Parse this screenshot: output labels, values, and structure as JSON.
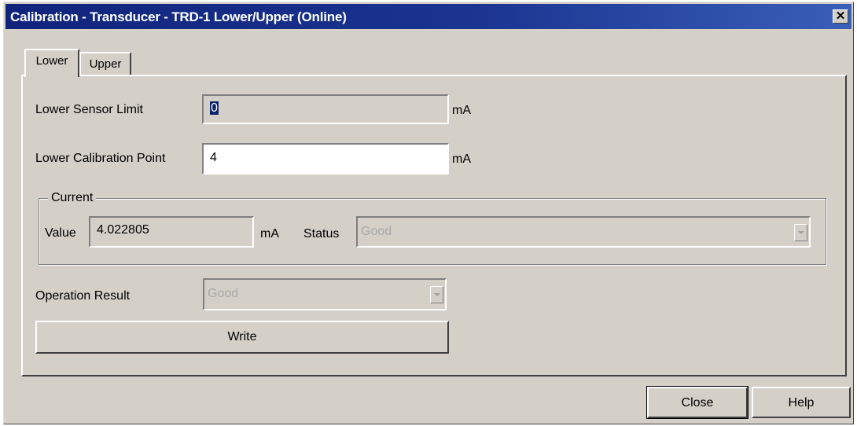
{
  "window": {
    "title": "Calibration - Transducer - TRD-1 Lower/Upper  (Online)",
    "close_glyph": "✕",
    "title_bar_color": "#10247c"
  },
  "tabs": [
    {
      "label": "Lower",
      "selected": true
    },
    {
      "label": "Upper",
      "selected": false
    }
  ],
  "lower_sensor_limit": {
    "label": "Lower Sensor Limit",
    "value": "0",
    "unit": "mA"
  },
  "lower_calibration_point": {
    "label": "Lower Calibration Point",
    "value": "4",
    "unit": "mA"
  },
  "current": {
    "group_label": "Current",
    "value_label": "Value",
    "value": "4.022805",
    "unit": "mA",
    "status_label": "Status",
    "status_value": "Good",
    "dropdown_icon": "chevron-down-icon"
  },
  "operation_result": {
    "label": "Operation Result",
    "value": "Good",
    "dropdown_icon": "chevron-down-icon"
  },
  "buttons": {
    "write": "Write",
    "close": "Close",
    "help": "Help"
  }
}
